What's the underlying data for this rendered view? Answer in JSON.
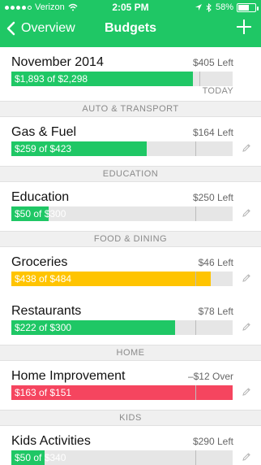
{
  "status": {
    "carrier": "Verizon",
    "time": "2:05 PM",
    "battery": "58%"
  },
  "nav": {
    "back_label": "Overview",
    "title": "Budgets"
  },
  "overview": {
    "name": "November 2014",
    "left_text": "$405 Left",
    "amount_text": "$1,893 of $2,298",
    "today_label": "TODAY",
    "progress": 0.82,
    "today_marker": 0.85,
    "color": "#1fc765"
  },
  "sections": [
    {
      "title": "AUTO & TRANSPORT",
      "items": [
        {
          "name": "Gas & Fuel",
          "left_text": "$164 Left",
          "amount_text": "$259 of $423",
          "progress": 0.61,
          "marker": 0.83,
          "color": "#1fc765"
        }
      ]
    },
    {
      "title": "EDUCATION",
      "items": [
        {
          "name": "Education",
          "left_text": "$250 Left",
          "amount_text": "$50 of $300",
          "progress": 0.17,
          "marker": 0.83,
          "color": "#1fc765"
        }
      ]
    },
    {
      "title": "FOOD & DINING",
      "items": [
        {
          "name": "Groceries",
          "left_text": "$46 Left",
          "amount_text": "$438 of $484",
          "progress": 0.9,
          "marker": 0.83,
          "color": "#ffc400"
        },
        {
          "name": "Restaurants",
          "left_text": "$78 Left",
          "amount_text": "$222 of $300",
          "progress": 0.74,
          "marker": 0.83,
          "color": "#1fc765"
        }
      ]
    },
    {
      "title": "HOME",
      "items": [
        {
          "name": "Home Improvement",
          "left_text": "–$12 Over",
          "amount_text": "$163 of $151",
          "progress": 1.0,
          "marker": 0.83,
          "color": "#f5455f"
        }
      ]
    },
    {
      "title": "KIDS",
      "items": [
        {
          "name": "Kids Activities",
          "left_text": "$290 Left",
          "amount_text": "$50 of $340",
          "progress": 0.15,
          "marker": 0.83,
          "color": "#1fc765"
        }
      ]
    }
  ],
  "icons": {
    "back": "chevron-left-icon",
    "add": "plus-icon",
    "edit": "pencil-icon",
    "wifi": "wifi-icon",
    "location": "location-arrow-icon",
    "bluetooth": "bluetooth-icon",
    "battery": "battery-icon"
  }
}
